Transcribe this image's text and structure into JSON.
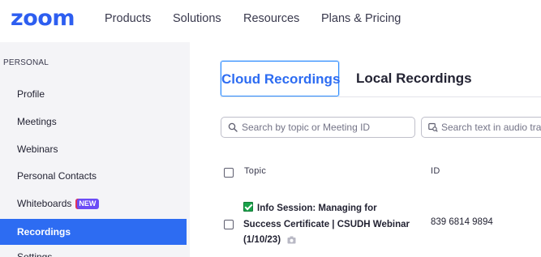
{
  "brand": {
    "logo": "zoom",
    "color": "#2d5ef0"
  },
  "nav": {
    "links": [
      "Products",
      "Solutions",
      "Resources",
      "Plans & Pricing"
    ]
  },
  "sidebar": {
    "section_title": "PERSONAL",
    "items": [
      {
        "label": "Profile"
      },
      {
        "label": "Meetings"
      },
      {
        "label": "Webinars"
      },
      {
        "label": "Personal Contacts"
      },
      {
        "label": "Whiteboards",
        "badge": "NEW"
      },
      {
        "label": "Recordings",
        "active": true
      },
      {
        "label": "Settings"
      }
    ],
    "active_color": "#2d6cf2"
  },
  "tabs": {
    "cloud": "Cloud Recordings",
    "local": "Local Recordings",
    "selected": "cloud"
  },
  "search": {
    "topic_placeholder": "Search by topic or Meeting ID",
    "audio_placeholder": "Search text in audio tra"
  },
  "table": {
    "headers": {
      "topic": "Topic",
      "id": "ID"
    },
    "rows": [
      {
        "topic_line1": "Info Session: Managing for",
        "topic_line2": "Success Certificate | CSUDH Webinar",
        "topic_line3": "(1/10/23)",
        "id": "839 6814 9894",
        "checked_icon": "green-check-icon",
        "media_icon": "camera-icon"
      }
    ]
  }
}
